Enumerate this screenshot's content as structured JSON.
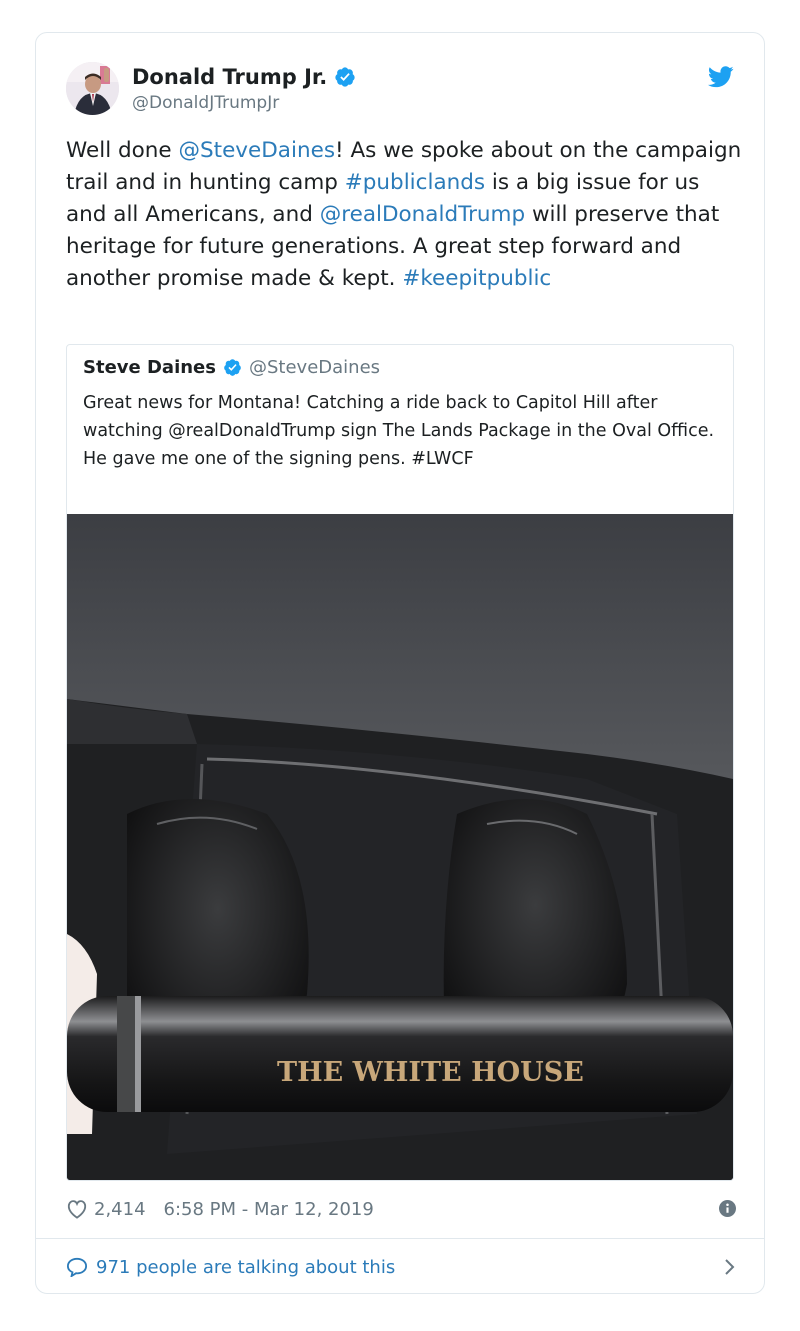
{
  "tweet": {
    "author": {
      "name": "Donald Trump Jr.",
      "handle": "@DonaldJTrumpJr"
    },
    "text_parts": [
      {
        "t": "Well done ",
        "link": false
      },
      {
        "t": "@SteveDaines",
        "link": true
      },
      {
        "t": "! As we spoke about on the campaign trail and in hunting camp ",
        "link": false
      },
      {
        "t": "#publiclands",
        "link": true
      },
      {
        "t": " is a big issue for us and all Americans, and ",
        "link": false
      },
      {
        "t": "@realDonaldTrump",
        "link": true
      },
      {
        "t": " will preserve that heritage for future generations. A great step forward and another promise made & kept. ",
        "link": false
      },
      {
        "t": "#keepitpublic",
        "link": true
      }
    ],
    "likes": "2,414",
    "timestamp": "6:58 PM - Mar 12, 2019",
    "talking": "971 people are talking about this"
  },
  "quoted": {
    "name": "Steve Daines",
    "handle": "@SteveDaines",
    "text": "Great news for Montana!  Catching a ride back to Capitol Hill after watching   @realDonaldTrump sign The Lands Package in the Oval Office.  He gave me one of the signing pens. #LWCF",
    "image_pen_text": "THE WHITE HOUSE"
  },
  "colors": {
    "link": "#2b7bb9",
    "verified": "#1da1f2",
    "muted": "#697882",
    "border": "#e1e8ed"
  },
  "icons": [
    "verified-badge-icon",
    "twitter-bird-icon",
    "heart-icon",
    "info-icon",
    "speech-bubble-icon",
    "chevron-right-icon"
  ]
}
